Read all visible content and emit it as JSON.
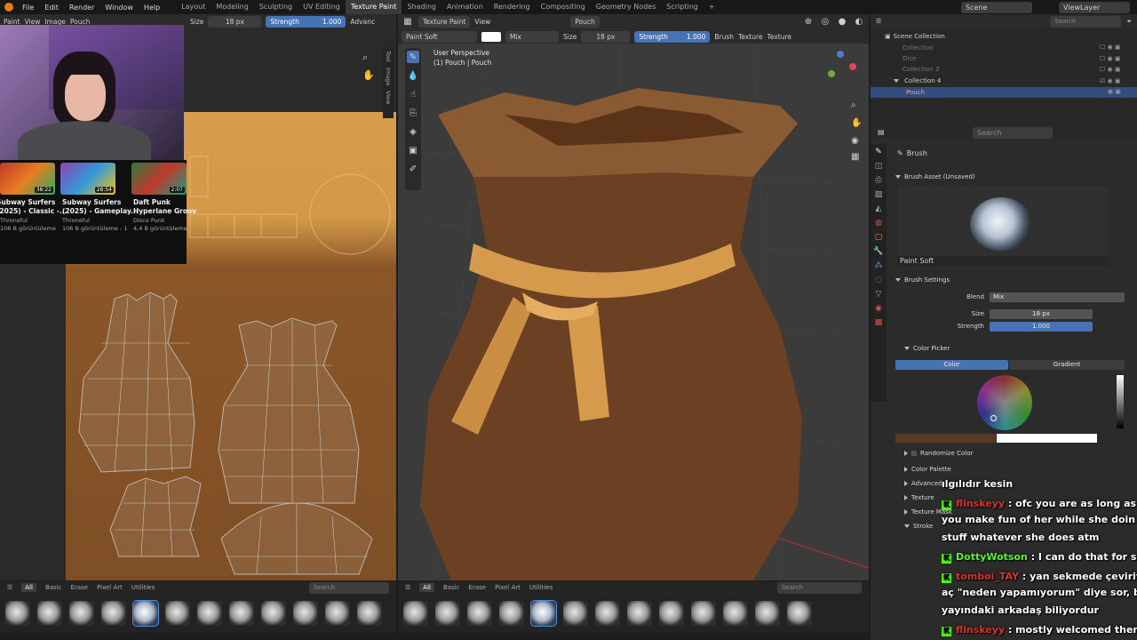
{
  "menubar": {
    "menus": [
      "File",
      "Edit",
      "Render",
      "Window",
      "Help"
    ],
    "workspaces": [
      "Layout",
      "Modeling",
      "Sculpting",
      "UV Editing",
      "Texture Paint",
      "Shading",
      "Animation",
      "Rendering",
      "Compositing",
      "Geometry Nodes",
      "Scripting"
    ],
    "active_workspace": "Texture Paint",
    "scene": "Scene",
    "view_layer": "ViewLayer",
    "search_placeholder": "Search"
  },
  "uv_editor": {
    "mode": "Paint",
    "view_menu": "View",
    "image_menu": "Image",
    "image_name": "Pouch",
    "size_label": "Size",
    "size_value": "18 px",
    "strength_label": "Strength",
    "strength_value": "1.000",
    "advanced_label": "Advanc",
    "side_tabs": [
      "Tool",
      "Image",
      "View"
    ]
  },
  "viewport": {
    "mode": "Texture Paint",
    "view_menu": "View",
    "object": "Pouch",
    "brush_name": "Paint Soft",
    "blend_value": "Mix",
    "size_label": "Size",
    "size_value": "18 px",
    "strength_label": "Strength",
    "strength_value": "1.000",
    "brush_menu": "Brush",
    "texture_menu": "Texture",
    "texture_menu2": "Texture",
    "overlay_title": "User Perspective",
    "overlay_sub": "(1) Pouch | Pouch"
  },
  "shelf": {
    "tabs": [
      "All",
      "Basic",
      "Erase",
      "Pixel Art",
      "Utilities"
    ],
    "search_placeholder": "Search"
  },
  "outliner": {
    "root": "Scene Collection",
    "items": [
      "Collection",
      "Dice",
      "Collection 3",
      "Collection 4",
      "Pouch"
    ]
  },
  "properties": {
    "search_placeholder": "Search",
    "panel_title": "Brush",
    "asset_header": "Brush Asset (Unsaved)",
    "asset_name": "Paint Soft",
    "settings_header": "Brush Settings",
    "blend_label": "Blend",
    "blend_value": "Mix",
    "size_label": "Size",
    "size_value": "18 px",
    "strength_label": "Strength",
    "strength_value": "1.000",
    "color_picker_header": "Color Picker",
    "color_tab": "Color",
    "gradient_tab": "Gradient",
    "randomize_label": "Randomize Color",
    "collapsed_sections": [
      "Color Palette",
      "Advanced",
      "Texture",
      "Texture Mask",
      "Stroke"
    ]
  },
  "webcam_overlay": {
    "videos": [
      {
        "title": "Subway Surfers",
        "title2": "(2025) - Classic -...",
        "channel": "Throneful",
        "stats": "106 B görüntüleme",
        "duration": "38:22"
      },
      {
        "title": "Subway Surfers",
        "title2": "(2025) - Gameplay...",
        "channel": "Throneful",
        "stats": "106 B görüntüleme - 1",
        "duration": "28:54"
      },
      {
        "title": "Daft Punk",
        "title2": "Hyperlane Groov",
        "channel": "Disco Punk",
        "stats": "4,4 B görüntüleme -",
        "duration": "2:07"
      }
    ]
  },
  "chat": [
    {
      "user": "",
      "text": "ılgılıdır kesin",
      "badge": false,
      "user_color": ""
    },
    {
      "user": "flinskeyy",
      "text": ": ofc you are as long as",
      "badge": true,
      "user_color": "#d9342b"
    },
    {
      "user": "",
      "text": "you make fun of her while she doin her",
      "badge": false,
      "user_color": ""
    },
    {
      "user": "",
      "text": "stuff whatever she does atm",
      "badge": false,
      "user_color": ""
    },
    {
      "user": "DottyWotson",
      "text": ": I can do that for sure",
      "badge": true,
      "user_color": "#53fc18"
    },
    {
      "user": "tomboi_TAY",
      "text": ": yan sekmede çeviriyi",
      "badge": true,
      "user_color": "#d9342b"
    },
    {
      "user": "",
      "text": "aç \"neden yapamıyorum\" diye sor, belki",
      "badge": false,
      "user_color": ""
    },
    {
      "user": "",
      "text": "yayındaki arkadaş biliyordur",
      "badge": false,
      "user_color": ""
    },
    {
      "user": "flinskeyy",
      "text": ": mostly welcomed then",
      "badge": true,
      "user_color": "#d9342b"
    }
  ],
  "colors": {
    "accent_blue": "#4772b3",
    "pouch_body": "#6b4023",
    "pouch_tie": "#d69a4c",
    "texture_orange": "#d79d4c",
    "kick_green": "#53fc18"
  }
}
